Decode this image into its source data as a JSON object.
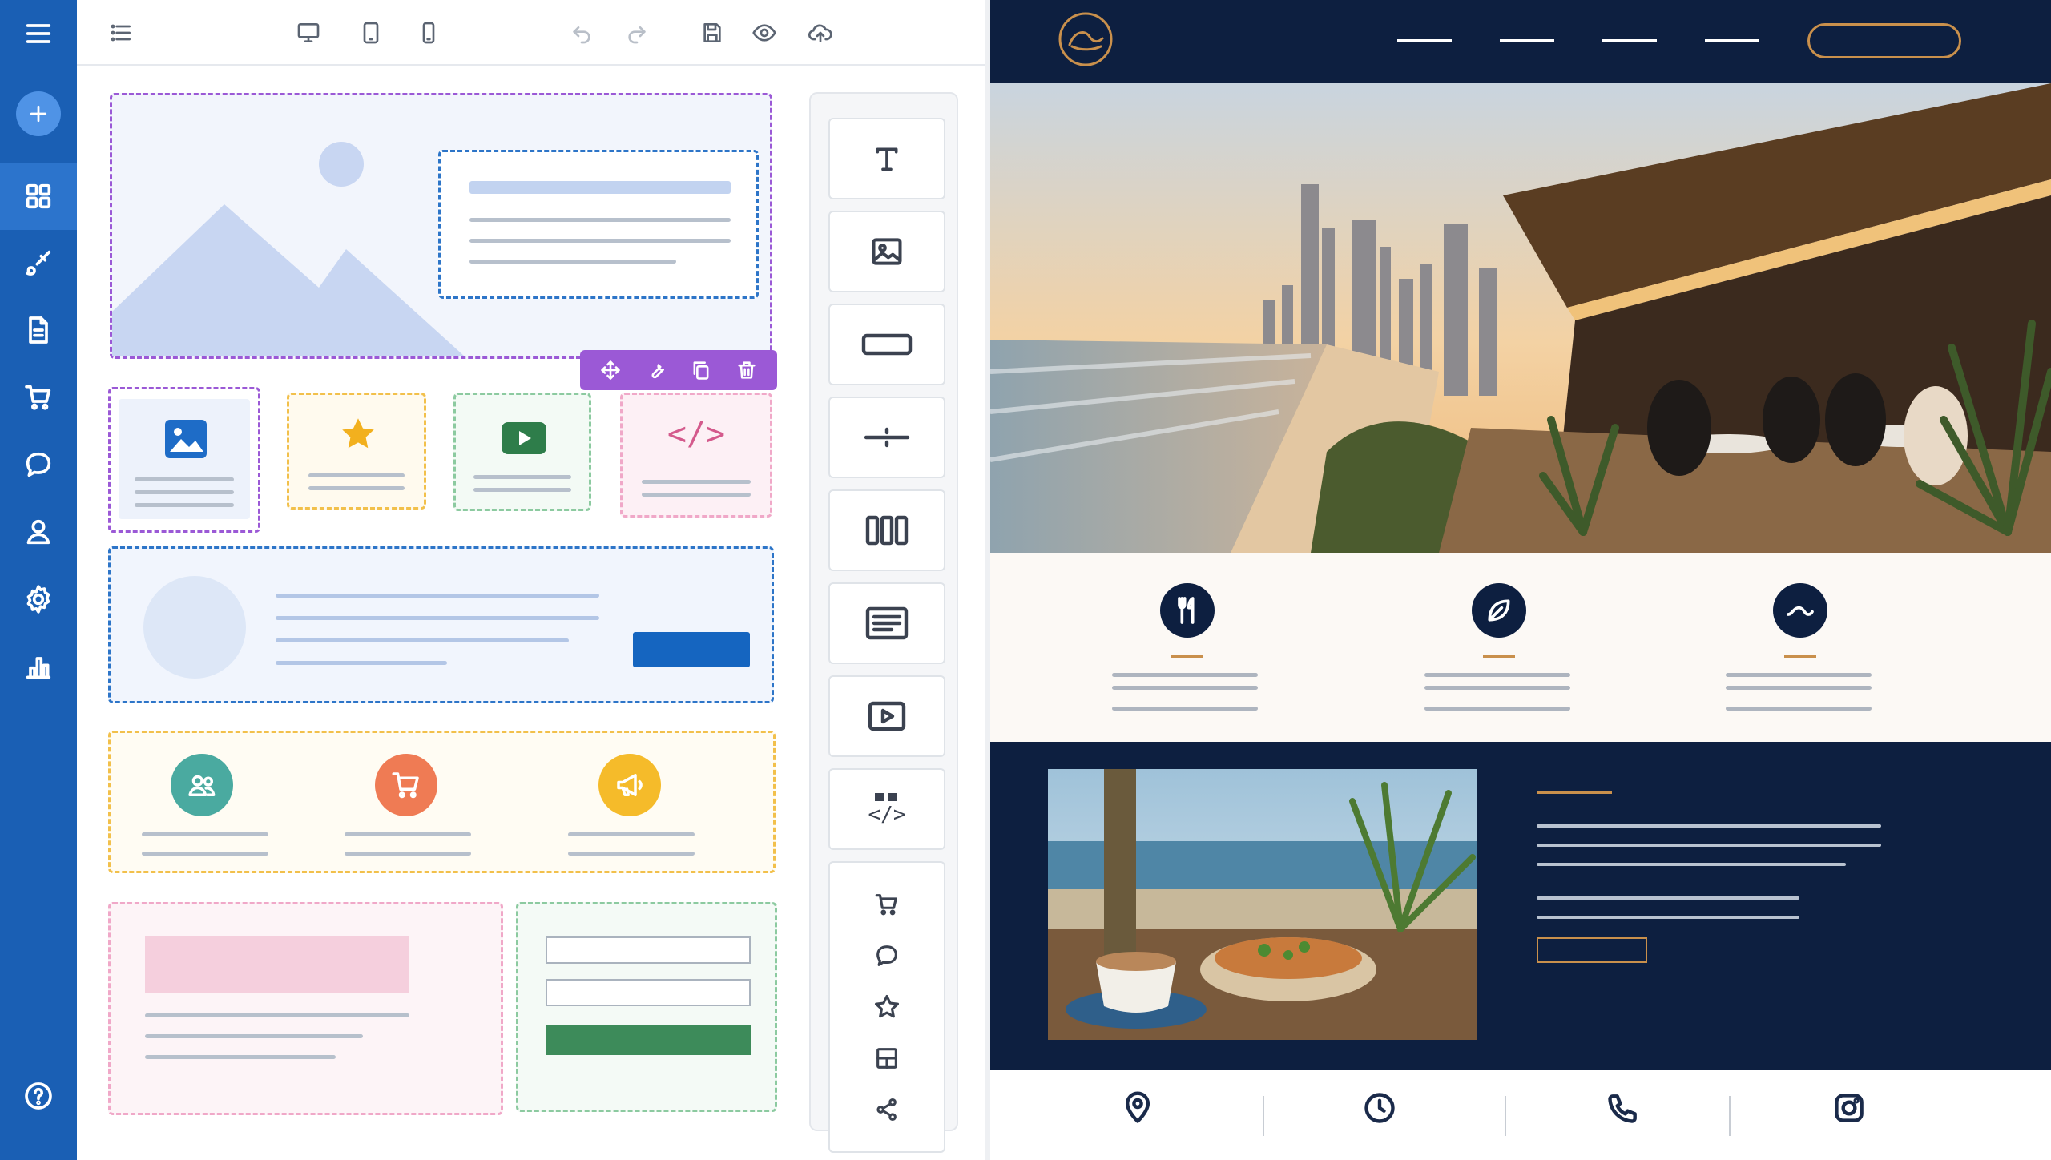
{
  "colors": {
    "nav_bg": "#1a5fb4",
    "selection_purple": "#9b59d6",
    "preview_navy": "#0d1f40",
    "preview_gold": "#c9904c",
    "cta_blue": "#1565c0",
    "form_green": "#3d8b5a"
  },
  "sidebar": {
    "items": [
      {
        "icon": "menu-icon"
      },
      {
        "icon": "add-icon"
      },
      {
        "icon": "widgets-grid-icon",
        "active": true
      },
      {
        "icon": "brush-icon"
      },
      {
        "icon": "page-icon"
      },
      {
        "icon": "cart-icon"
      },
      {
        "icon": "chat-icon"
      },
      {
        "icon": "user-icon"
      },
      {
        "icon": "settings-icon"
      },
      {
        "icon": "analytics-icon"
      },
      {
        "icon": "help-icon"
      }
    ]
  },
  "toolbar": {
    "icons": [
      "layers-icon",
      "desktop-icon",
      "tablet-icon",
      "mobile-icon",
      "undo-icon",
      "redo-icon",
      "save-icon",
      "preview-eye-icon",
      "publish-cloud-icon"
    ]
  },
  "selection_toolbar": {
    "icons": [
      "move-icon",
      "wrench-icon",
      "copy-icon",
      "trash-icon"
    ]
  },
  "canvas": {
    "code_block_glyph": "</>"
  },
  "palette": {
    "widgets": [
      "text-widget-icon",
      "image-widget-icon",
      "button-widget-icon",
      "divider-widget-icon",
      "columns-widget-icon",
      "text-block-widget-icon",
      "video-widget-icon",
      "embed-code-widget-icon"
    ],
    "extra_group": [
      "cart-icon",
      "chat-icon",
      "star-icon",
      "layout-icon",
      "share-icon"
    ],
    "embed_glyph": "</>"
  },
  "preview": {
    "logo": "wave-logo",
    "features": [
      "fork-knife-icon",
      "leaf-icon",
      "wave-icon"
    ],
    "footer_icons": [
      "location-pin-icon",
      "clock-icon",
      "phone-icon",
      "instagram-icon"
    ]
  }
}
